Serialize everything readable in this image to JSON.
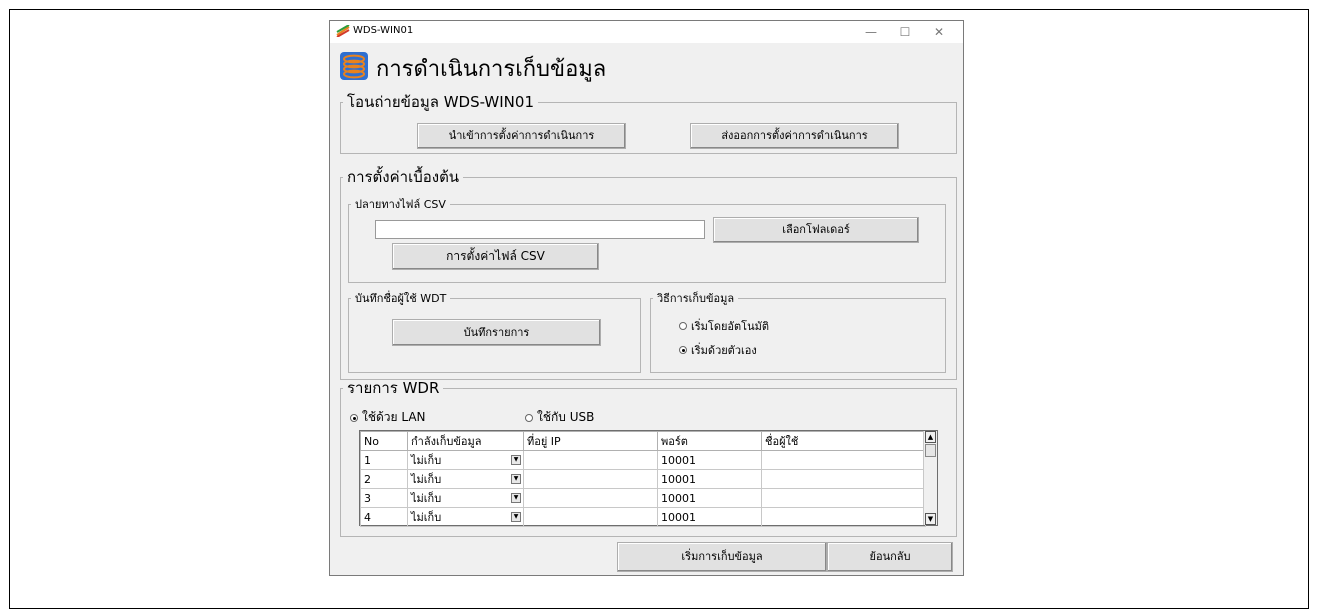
{
  "window": {
    "title": "WDS-WIN01",
    "minimize": "—",
    "maximize": "☐",
    "close": "✕"
  },
  "header": {
    "title": "การดำเนินการเก็บข้อมูล"
  },
  "transfer_group": {
    "legend": "โอนถ่ายข้อมูล WDS-WIN01",
    "import_label": "นำเข้าการตั้งค่าการดำเนินการ",
    "export_label": "ส่งออกการตั้งค่าการดำเนินการ"
  },
  "initial_group": {
    "legend": "การตั้งค่าเบื้องต้น",
    "csv": {
      "legend": "ปลายทางไฟล์ CSV",
      "path_value": "",
      "select_folder_label": "เลือกโฟลเดอร์",
      "csv_settings_label": "การตั้งค่าไฟล์ CSV"
    },
    "user_log": {
      "legend": "บันทึกชื่อผู้ใช้ WDT",
      "log_button_label": "บันทึกรายการ"
    },
    "method": {
      "legend": "วิธีการเก็บข้อมูล",
      "auto_label": "เริ่มโดยอัตโนมัติ",
      "manual_label": "เริ่มด้วยตัวเอง",
      "selected": "manual"
    }
  },
  "wdr_group": {
    "legend": "รายการ WDR",
    "lan_label": "ใช้ด้วย LAN",
    "usb_label": "ใช้กับ USB",
    "selected": "lan",
    "columns": [
      "No",
      "กำลังเก็บข้อมูล",
      "ที่อยู่ IP",
      "พอร์ต",
      "ชื่อผู้ใช้"
    ],
    "rows": [
      {
        "no": "1",
        "collecting": "ไม่เก็บ",
        "ip": "",
        "port": "10001",
        "user": ""
      },
      {
        "no": "2",
        "collecting": "ไม่เก็บ",
        "ip": "",
        "port": "10001",
        "user": ""
      },
      {
        "no": "3",
        "collecting": "ไม่เก็บ",
        "ip": "",
        "port": "10001",
        "user": ""
      },
      {
        "no": "4",
        "collecting": "ไม่เก็บ",
        "ip": "",
        "port": "10001",
        "user": ""
      }
    ]
  },
  "footer": {
    "start_label": "เริ่มการเก็บข้อมูล",
    "back_label": "ย้อนกลับ"
  },
  "icons": {
    "app": "stacked-disks-icon",
    "dropdown": "dropdown-arrow-icon",
    "scroll_up": "scroll-up-icon",
    "scroll_down": "scroll-down-icon"
  },
  "colors": {
    "window_bg": "#f0f0f0",
    "button_bg": "#e1e1e1",
    "icon_blue": "#2f6fd0",
    "icon_orange": "#e8821e"
  }
}
